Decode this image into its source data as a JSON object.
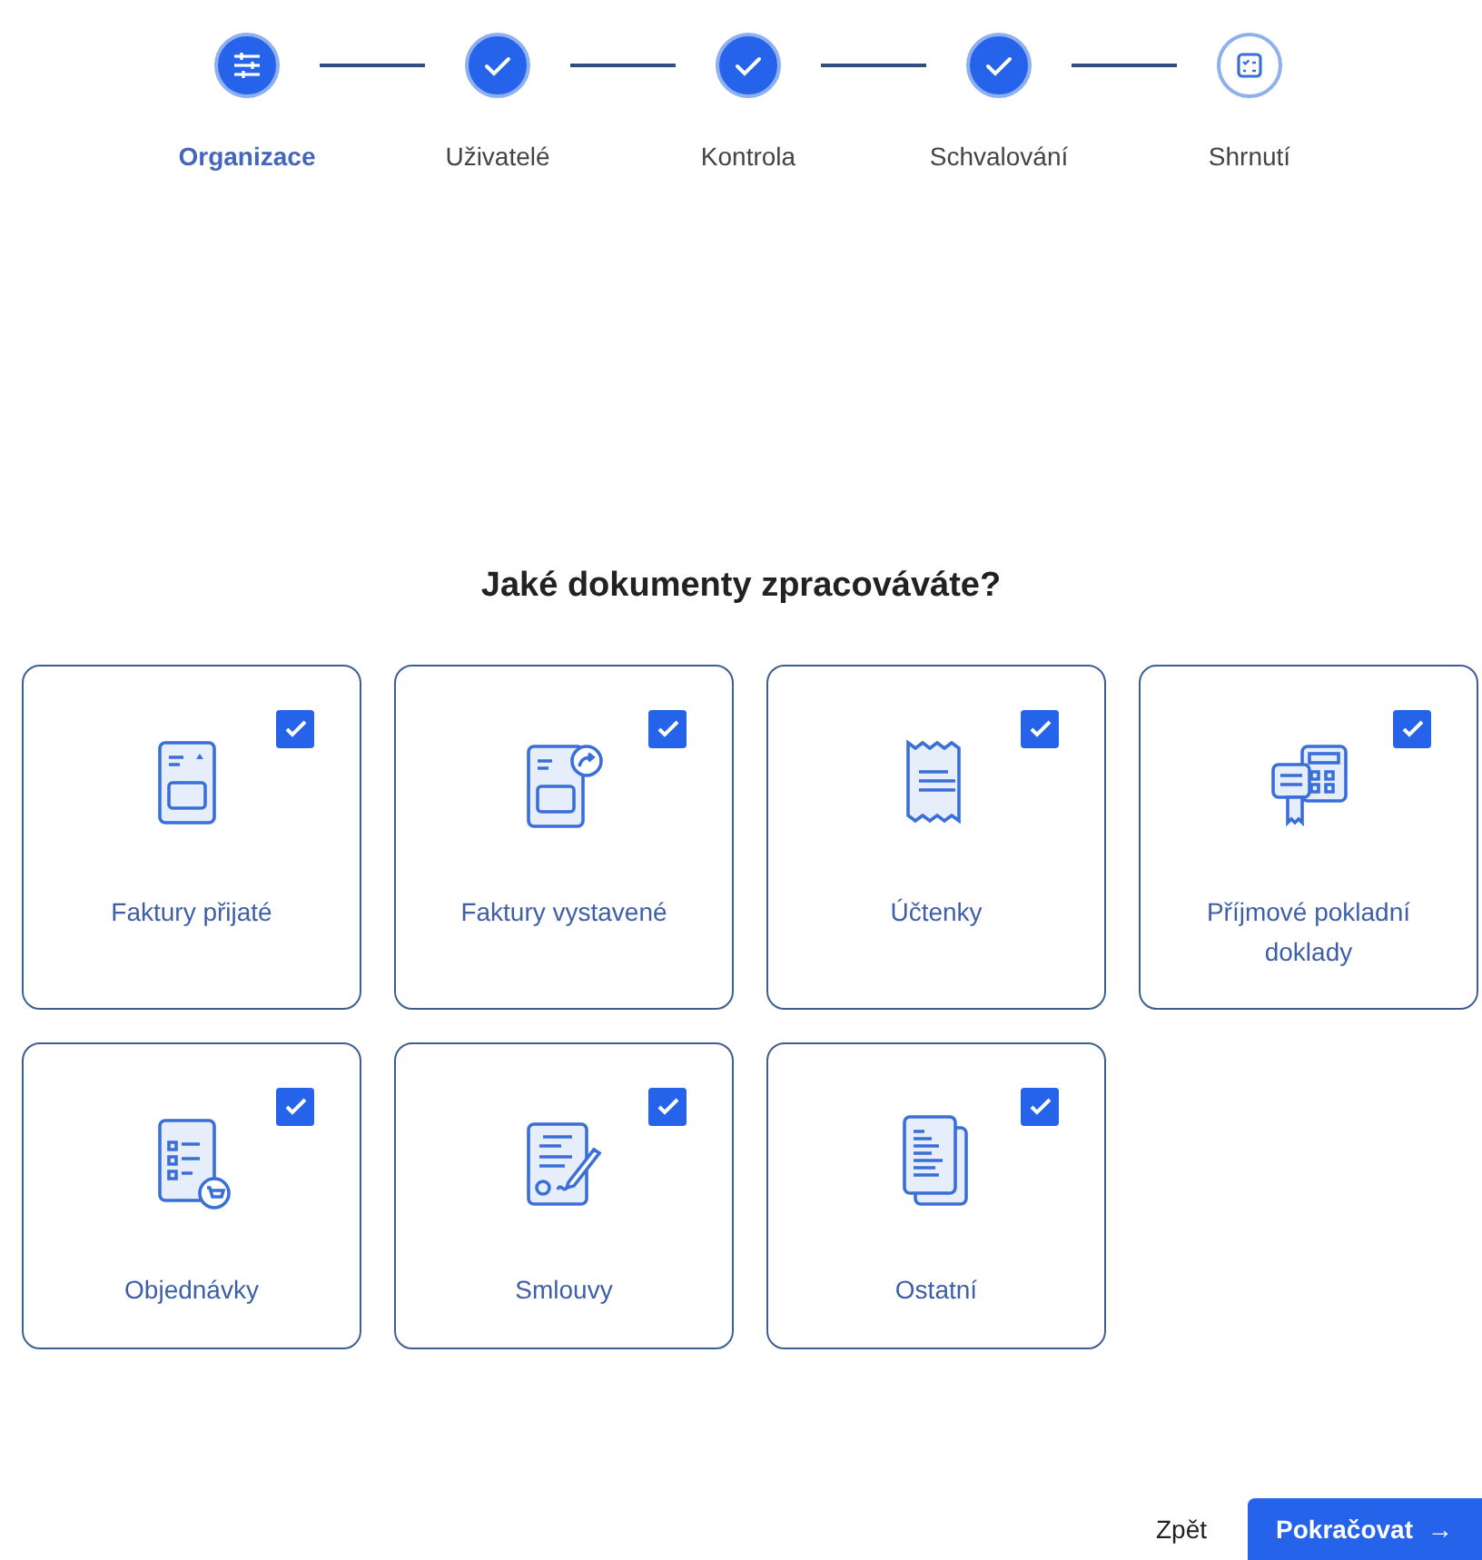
{
  "stepper": [
    {
      "label": "Organizace",
      "kind": "current",
      "selected": true
    },
    {
      "label": "Uživatelé",
      "kind": "done",
      "selected": false
    },
    {
      "label": "Kontrola",
      "kind": "done",
      "selected": false
    },
    {
      "label": "Schvalování",
      "kind": "done",
      "selected": false
    },
    {
      "label": "Shrnutí",
      "kind": "pending",
      "selected": false
    }
  ],
  "heading": "Jaké dokumenty zpracováváte?",
  "documents": [
    {
      "label": "Faktury přijaté",
      "checked": true
    },
    {
      "label": "Faktury vystavené",
      "checked": true
    },
    {
      "label": "Účtenky",
      "checked": true
    },
    {
      "label": "Příjmové pokladní doklady",
      "checked": true
    },
    {
      "label": "Objednávky",
      "checked": true
    },
    {
      "label": "Smlouvy",
      "checked": true
    },
    {
      "label": "Ostatní",
      "checked": true
    }
  ],
  "footer": {
    "back": "Zpět",
    "next": "Pokračovat",
    "next_arrow": "→"
  }
}
